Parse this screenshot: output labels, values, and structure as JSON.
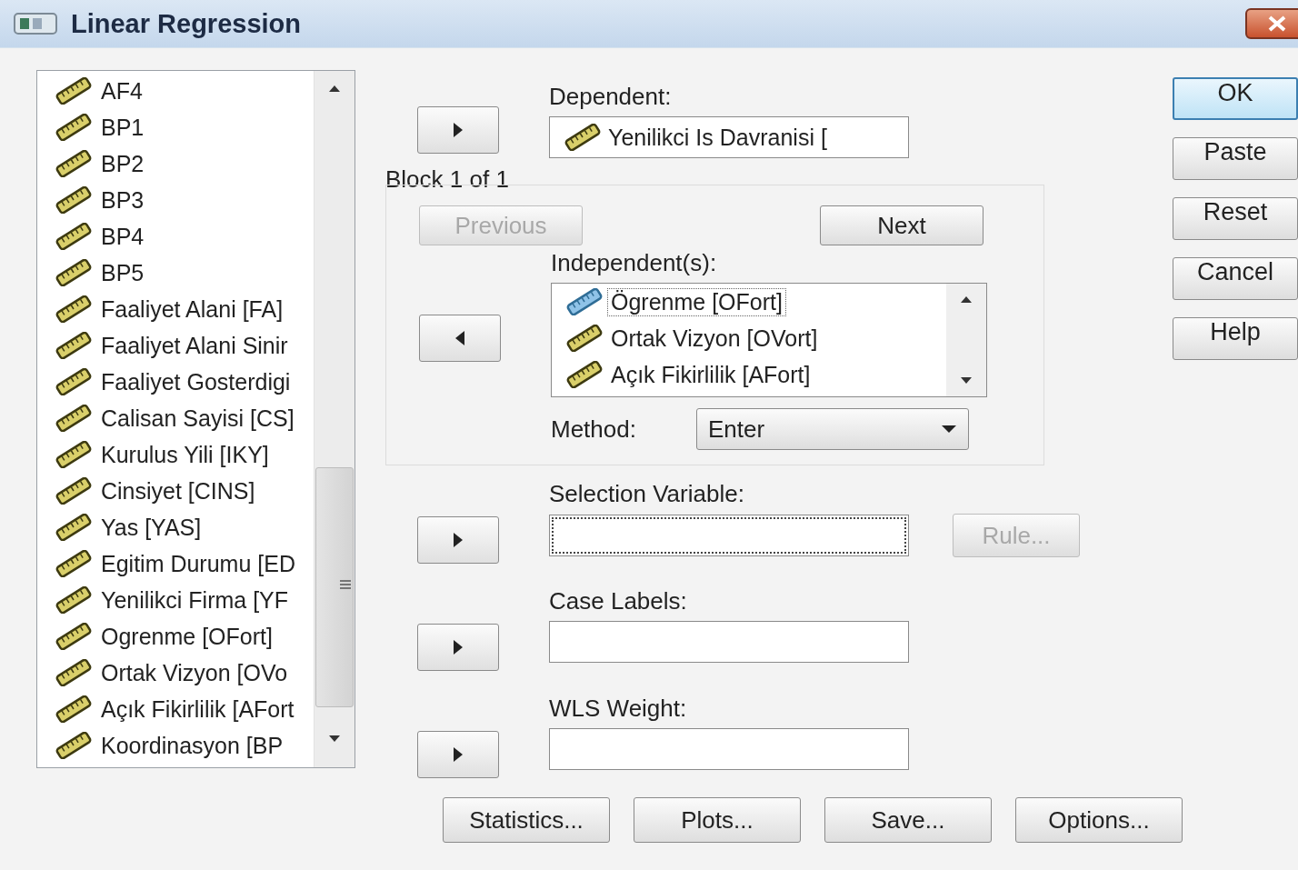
{
  "window": {
    "title": "Linear Regression"
  },
  "variables": [
    {
      "label": "AF4"
    },
    {
      "label": "BP1"
    },
    {
      "label": "BP2"
    },
    {
      "label": "BP3"
    },
    {
      "label": "BP4"
    },
    {
      "label": "BP5"
    },
    {
      "label": "Faaliyet Alani [FA]"
    },
    {
      "label": "Faaliyet Alani Sinir"
    },
    {
      "label": "Faaliyet Gosterdigi"
    },
    {
      "label": "Calisan Sayisi [CS]"
    },
    {
      "label": "Kurulus Yili [IKY]"
    },
    {
      "label": "Cinsiyet [CINS]"
    },
    {
      "label": "Yas [YAS]"
    },
    {
      "label": "Egitim Durumu [ED"
    },
    {
      "label": "Yenilikci Firma [YF"
    },
    {
      "label": "Ogrenme [OFort]"
    },
    {
      "label": "Ortak Vizyon [OVo"
    },
    {
      "label": "Açık Fikirlilik [AFort"
    },
    {
      "label": "Koordinasyon [BP"
    }
  ],
  "dependent": {
    "kind": "right",
    "label": "Dependent:",
    "value": "Yenilikci Is Davranisi ["
  },
  "block": {
    "label": "Block 1 of 1",
    "buttons": [
      {
        "label": "Previous",
        "disabled": true
      },
      {
        "label": "Next",
        "disabled": false
      }
    ],
    "kind": "left",
    "independents_label": "Independent(s):",
    "independents": [
      {
        "label": "Ögrenme [OFort]",
        "selected": true
      },
      {
        "label": "Ortak Vizyon [OVort]",
        "selected": false
      },
      {
        "label": "Açık Fikirlilik [AFort]",
        "selected": false
      }
    ],
    "method_label": "Method:",
    "method": "Enter"
  },
  "fields": [
    {
      "kind": "right",
      "label": "Selection Variable:",
      "focused": true,
      "rule": {
        "label": "Rule...",
        "disabled": true
      }
    },
    {
      "kind": "right",
      "label": "Case Labels:",
      "focused": false
    },
    {
      "kind": "right",
      "label": "WLS Weight:",
      "focused": false
    }
  ],
  "side_buttons": [
    {
      "label": "OK",
      "default": true
    },
    {
      "label": "Paste",
      "default": false
    },
    {
      "label": "Reset",
      "default": false
    },
    {
      "label": "Cancel",
      "default": false
    },
    {
      "label": "Help",
      "default": false
    }
  ],
  "bottom_buttons": [
    "Statistics...",
    "Plots...",
    "Save...",
    "Options..."
  ]
}
